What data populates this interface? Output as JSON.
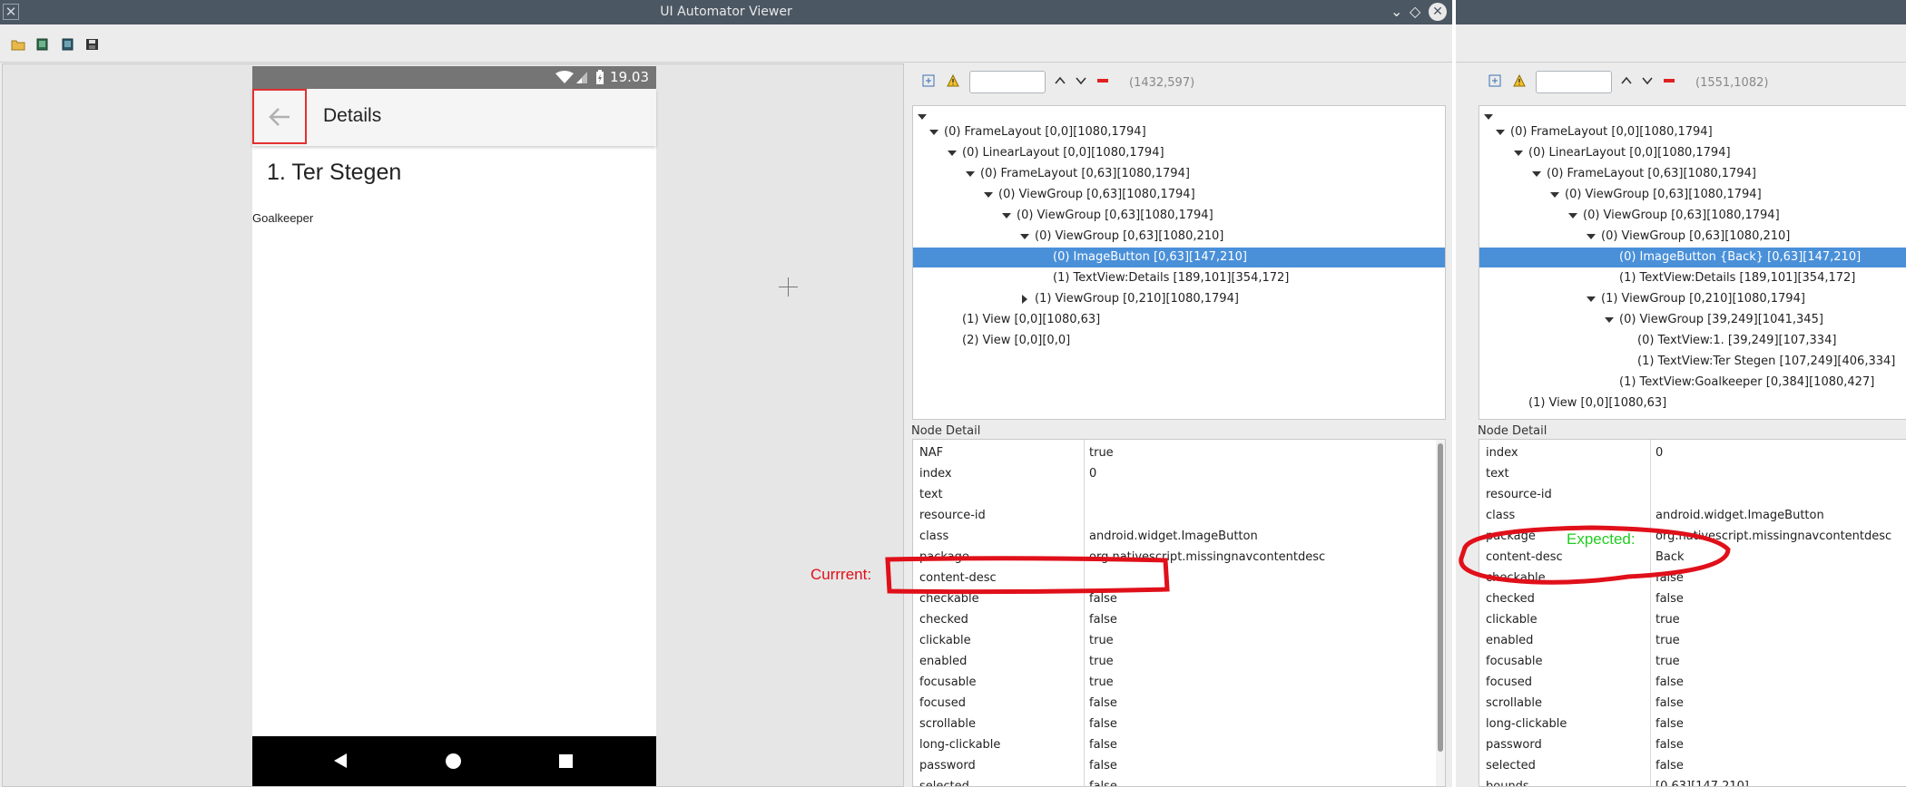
{
  "window": {
    "title": "UI Automator Viewer"
  },
  "device": {
    "status_time": "19.03",
    "app_title": "Details",
    "player_name": "1. Ter Stegen",
    "player_position": "Goalkeeper"
  },
  "left_hierarchy": {
    "coords": "(1432,597)",
    "nodes": [
      {
        "label": "(0) FrameLayout [0,0][1080,1794]",
        "depth": 1,
        "toggle": "down"
      },
      {
        "label": "(0) LinearLayout [0,0][1080,1794]",
        "depth": 2,
        "toggle": "down"
      },
      {
        "label": "(0) FrameLayout [0,63][1080,1794]",
        "depth": 3,
        "toggle": "down"
      },
      {
        "label": "(0) ViewGroup [0,63][1080,1794]",
        "depth": 4,
        "toggle": "down"
      },
      {
        "label": "(0) ViewGroup [0,63][1080,1794]",
        "depth": 5,
        "toggle": "down"
      },
      {
        "label": "(0) ViewGroup [0,63][1080,210]",
        "depth": 6,
        "toggle": "down"
      },
      {
        "label": "(0) ImageButton [0,63][147,210]",
        "depth": 7,
        "toggle": "none",
        "selected": true
      },
      {
        "label": "(1) TextView:Details [189,101][354,172]",
        "depth": 7,
        "toggle": "none"
      },
      {
        "label": "(1) ViewGroup [0,210][1080,1794]",
        "depth": 6,
        "toggle": "right"
      },
      {
        "label": "(1) View [0,0][1080,63]",
        "depth": 2,
        "toggle": "none"
      },
      {
        "label": "(2) View [0,0][0,0]",
        "depth": 2,
        "toggle": "none"
      }
    ]
  },
  "left_detail": {
    "label": "Node Detail",
    "rows": [
      {
        "key": "NAF",
        "value": "true"
      },
      {
        "key": "index",
        "value": "0"
      },
      {
        "key": "text",
        "value": ""
      },
      {
        "key": "resource-id",
        "value": ""
      },
      {
        "key": "class",
        "value": "android.widget.ImageButton"
      },
      {
        "key": "package",
        "value": "org.nativescript.missingnavcontentdesc"
      },
      {
        "key": "content-desc",
        "value": ""
      },
      {
        "key": "checkable",
        "value": "false"
      },
      {
        "key": "checked",
        "value": "false"
      },
      {
        "key": "clickable",
        "value": "true"
      },
      {
        "key": "enabled",
        "value": "true"
      },
      {
        "key": "focusable",
        "value": "true"
      },
      {
        "key": "focused",
        "value": "false"
      },
      {
        "key": "scrollable",
        "value": "false"
      },
      {
        "key": "long-clickable",
        "value": "false"
      },
      {
        "key": "password",
        "value": "false"
      },
      {
        "key": "selected",
        "value": "false"
      }
    ]
  },
  "right_hierarchy": {
    "coords": "(1551,1082)",
    "nodes": [
      {
        "label": "(0) FrameLayout [0,0][1080,1794]",
        "depth": 1,
        "toggle": "down"
      },
      {
        "label": "(0) LinearLayout [0,0][1080,1794]",
        "depth": 2,
        "toggle": "down"
      },
      {
        "label": "(0) FrameLayout [0,63][1080,1794]",
        "depth": 3,
        "toggle": "down"
      },
      {
        "label": "(0) ViewGroup [0,63][1080,1794]",
        "depth": 4,
        "toggle": "down"
      },
      {
        "label": "(0) ViewGroup [0,63][1080,1794]",
        "depth": 5,
        "toggle": "down"
      },
      {
        "label": "(0) ViewGroup [0,63][1080,210]",
        "depth": 6,
        "toggle": "down"
      },
      {
        "label": "(0) ImageButton {Back} [0,63][147,210]",
        "depth": 7,
        "toggle": "none",
        "selected": true
      },
      {
        "label": "(1) TextView:Details [189,101][354,172]",
        "depth": 7,
        "toggle": "none"
      },
      {
        "label": "(1) ViewGroup [0,210][1080,1794]",
        "depth": 6,
        "toggle": "down"
      },
      {
        "label": "(0) ViewGroup [39,249][1041,345]",
        "depth": 7,
        "toggle": "down"
      },
      {
        "label": "(0) TextView:1.  [39,249][107,334]",
        "depth": 8,
        "toggle": "none"
      },
      {
        "label": "(1) TextView:Ter Stegen [107,249][406,334]",
        "depth": 8,
        "toggle": "none"
      },
      {
        "label": "(1) TextView:Goalkeeper [0,384][1080,427]",
        "depth": 7,
        "toggle": "none"
      },
      {
        "label": "(1) View [0,0][1080,63]",
        "depth": 2,
        "toggle": "none"
      }
    ]
  },
  "right_detail": {
    "label": "Node Detail",
    "rows": [
      {
        "key": "index",
        "value": "0"
      },
      {
        "key": "text",
        "value": ""
      },
      {
        "key": "resource-id",
        "value": ""
      },
      {
        "key": "class",
        "value": "android.widget.ImageButton"
      },
      {
        "key": "package",
        "value": "org.nativescript.missingnavcontentdesc"
      },
      {
        "key": "content-desc",
        "value": "Back"
      },
      {
        "key": "checkable",
        "value": "false"
      },
      {
        "key": "checked",
        "value": "false"
      },
      {
        "key": "clickable",
        "value": "true"
      },
      {
        "key": "enabled",
        "value": "true"
      },
      {
        "key": "focusable",
        "value": "true"
      },
      {
        "key": "focused",
        "value": "false"
      },
      {
        "key": "scrollable",
        "value": "false"
      },
      {
        "key": "long-clickable",
        "value": "false"
      },
      {
        "key": "password",
        "value": "false"
      },
      {
        "key": "selected",
        "value": "false"
      },
      {
        "key": "bounds",
        "value": "[0,63][147,210]"
      }
    ]
  },
  "annotations": {
    "current": "Currrent:",
    "expected": "Expected:",
    "current_color": "#e0101a",
    "expected_color": "#22cc22"
  },
  "colors": {
    "selection": "#4a90d9",
    "titlebar": "#4b5763"
  }
}
